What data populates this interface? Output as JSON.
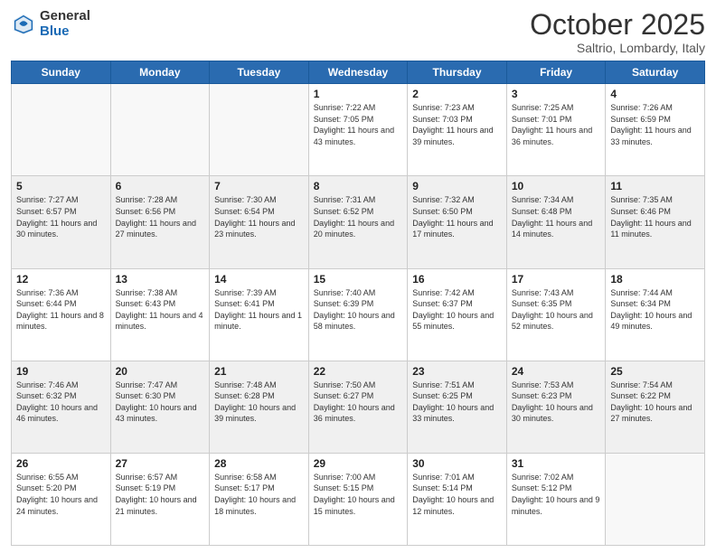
{
  "header": {
    "logo_general": "General",
    "logo_blue": "Blue",
    "month": "October 2025",
    "location": "Saltrio, Lombardy, Italy"
  },
  "days_of_week": [
    "Sunday",
    "Monday",
    "Tuesday",
    "Wednesday",
    "Thursday",
    "Friday",
    "Saturday"
  ],
  "weeks": [
    {
      "shaded": false,
      "days": [
        {
          "num": "",
          "info": ""
        },
        {
          "num": "",
          "info": ""
        },
        {
          "num": "",
          "info": ""
        },
        {
          "num": "1",
          "info": "Sunrise: 7:22 AM\nSunset: 7:05 PM\nDaylight: 11 hours and 43 minutes."
        },
        {
          "num": "2",
          "info": "Sunrise: 7:23 AM\nSunset: 7:03 PM\nDaylight: 11 hours and 39 minutes."
        },
        {
          "num": "3",
          "info": "Sunrise: 7:25 AM\nSunset: 7:01 PM\nDaylight: 11 hours and 36 minutes."
        },
        {
          "num": "4",
          "info": "Sunrise: 7:26 AM\nSunset: 6:59 PM\nDaylight: 11 hours and 33 minutes."
        }
      ]
    },
    {
      "shaded": true,
      "days": [
        {
          "num": "5",
          "info": "Sunrise: 7:27 AM\nSunset: 6:57 PM\nDaylight: 11 hours and 30 minutes."
        },
        {
          "num": "6",
          "info": "Sunrise: 7:28 AM\nSunset: 6:56 PM\nDaylight: 11 hours and 27 minutes."
        },
        {
          "num": "7",
          "info": "Sunrise: 7:30 AM\nSunset: 6:54 PM\nDaylight: 11 hours and 23 minutes."
        },
        {
          "num": "8",
          "info": "Sunrise: 7:31 AM\nSunset: 6:52 PM\nDaylight: 11 hours and 20 minutes."
        },
        {
          "num": "9",
          "info": "Sunrise: 7:32 AM\nSunset: 6:50 PM\nDaylight: 11 hours and 17 minutes."
        },
        {
          "num": "10",
          "info": "Sunrise: 7:34 AM\nSunset: 6:48 PM\nDaylight: 11 hours and 14 minutes."
        },
        {
          "num": "11",
          "info": "Sunrise: 7:35 AM\nSunset: 6:46 PM\nDaylight: 11 hours and 11 minutes."
        }
      ]
    },
    {
      "shaded": false,
      "days": [
        {
          "num": "12",
          "info": "Sunrise: 7:36 AM\nSunset: 6:44 PM\nDaylight: 11 hours and 8 minutes."
        },
        {
          "num": "13",
          "info": "Sunrise: 7:38 AM\nSunset: 6:43 PM\nDaylight: 11 hours and 4 minutes."
        },
        {
          "num": "14",
          "info": "Sunrise: 7:39 AM\nSunset: 6:41 PM\nDaylight: 11 hours and 1 minute."
        },
        {
          "num": "15",
          "info": "Sunrise: 7:40 AM\nSunset: 6:39 PM\nDaylight: 10 hours and 58 minutes."
        },
        {
          "num": "16",
          "info": "Sunrise: 7:42 AM\nSunset: 6:37 PM\nDaylight: 10 hours and 55 minutes."
        },
        {
          "num": "17",
          "info": "Sunrise: 7:43 AM\nSunset: 6:35 PM\nDaylight: 10 hours and 52 minutes."
        },
        {
          "num": "18",
          "info": "Sunrise: 7:44 AM\nSunset: 6:34 PM\nDaylight: 10 hours and 49 minutes."
        }
      ]
    },
    {
      "shaded": true,
      "days": [
        {
          "num": "19",
          "info": "Sunrise: 7:46 AM\nSunset: 6:32 PM\nDaylight: 10 hours and 46 minutes."
        },
        {
          "num": "20",
          "info": "Sunrise: 7:47 AM\nSunset: 6:30 PM\nDaylight: 10 hours and 43 minutes."
        },
        {
          "num": "21",
          "info": "Sunrise: 7:48 AM\nSunset: 6:28 PM\nDaylight: 10 hours and 39 minutes."
        },
        {
          "num": "22",
          "info": "Sunrise: 7:50 AM\nSunset: 6:27 PM\nDaylight: 10 hours and 36 minutes."
        },
        {
          "num": "23",
          "info": "Sunrise: 7:51 AM\nSunset: 6:25 PM\nDaylight: 10 hours and 33 minutes."
        },
        {
          "num": "24",
          "info": "Sunrise: 7:53 AM\nSunset: 6:23 PM\nDaylight: 10 hours and 30 minutes."
        },
        {
          "num": "25",
          "info": "Sunrise: 7:54 AM\nSunset: 6:22 PM\nDaylight: 10 hours and 27 minutes."
        }
      ]
    },
    {
      "shaded": false,
      "days": [
        {
          "num": "26",
          "info": "Sunrise: 6:55 AM\nSunset: 5:20 PM\nDaylight: 10 hours and 24 minutes."
        },
        {
          "num": "27",
          "info": "Sunrise: 6:57 AM\nSunset: 5:19 PM\nDaylight: 10 hours and 21 minutes."
        },
        {
          "num": "28",
          "info": "Sunrise: 6:58 AM\nSunset: 5:17 PM\nDaylight: 10 hours and 18 minutes."
        },
        {
          "num": "29",
          "info": "Sunrise: 7:00 AM\nSunset: 5:15 PM\nDaylight: 10 hours and 15 minutes."
        },
        {
          "num": "30",
          "info": "Sunrise: 7:01 AM\nSunset: 5:14 PM\nDaylight: 10 hours and 12 minutes."
        },
        {
          "num": "31",
          "info": "Sunrise: 7:02 AM\nSunset: 5:12 PM\nDaylight: 10 hours and 9 minutes."
        },
        {
          "num": "",
          "info": ""
        }
      ]
    }
  ]
}
